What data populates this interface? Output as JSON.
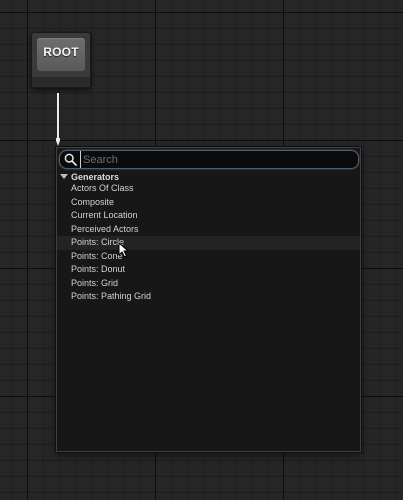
{
  "root_node": {
    "label": "ROOT"
  },
  "search": {
    "value": "",
    "placeholder": "Search"
  },
  "category": {
    "label": "Generators",
    "expanded": true
  },
  "items": [
    {
      "label": "Actors Of Class"
    },
    {
      "label": "Composite"
    },
    {
      "label": "Current Location"
    },
    {
      "label": "Perceived Actors"
    },
    {
      "label": "Points: Circle"
    },
    {
      "label": "Points: Cone"
    },
    {
      "label": "Points: Donut"
    },
    {
      "label": "Points: Grid"
    },
    {
      "label": "Points: Pathing Grid"
    }
  ],
  "hovered_item": "Points: Circle",
  "colors": {
    "graph_background": "#262626",
    "node_body": "#3a3a3a",
    "node_header": "#6e6e6e",
    "menu_background": "#171717",
    "search_border": "#4d5f73",
    "text": "#d2d2d2"
  },
  "icons": {
    "search": "search-icon",
    "expand": "triangle-down-icon",
    "cursor": "mouse-pointer-icon",
    "wire": "arrow-down-icon"
  }
}
